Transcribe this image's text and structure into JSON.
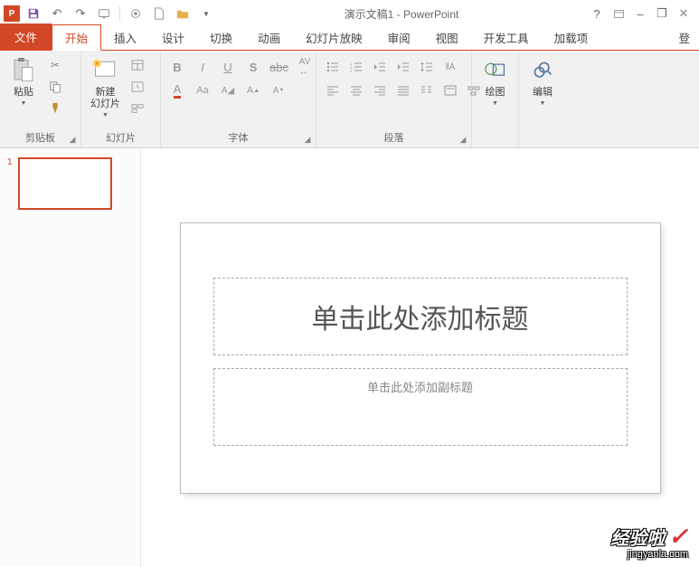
{
  "app": {
    "title": "演示文稿1 - PowerPoint"
  },
  "quick_access": {
    "save": "保存",
    "undo": "撤销",
    "redo": "重做",
    "start": "从头开始",
    "touch": "触摸/鼠标模式",
    "new": "新建",
    "open": "打开"
  },
  "window_buttons": {
    "help": "?",
    "ribbon_display": "▭",
    "minimize": "–",
    "restore": "❐",
    "close": "✕"
  },
  "tabs": {
    "file": "文件",
    "home": "开始",
    "insert": "插入",
    "design": "设计",
    "transitions": "切换",
    "animations": "动画",
    "slideshow": "幻灯片放映",
    "review": "审阅",
    "view": "视图",
    "developer": "开发工具",
    "addins": "加载项",
    "login": "登"
  },
  "ribbon": {
    "clipboard": {
      "label": "剪贴板",
      "paste": "粘贴",
      "cut": "剪切",
      "copy": "复制",
      "format_painter": "格式刷"
    },
    "slides": {
      "label": "幻灯片",
      "new_slide": "新建\n幻灯片"
    },
    "font": {
      "label": "字体"
    },
    "paragraph": {
      "label": "段落"
    },
    "drawing": {
      "label": "绘图"
    },
    "editing": {
      "label": "编辑"
    }
  },
  "slide": {
    "number": "1",
    "title_placeholder": "单击此处添加标题",
    "subtitle_placeholder": "单击此处添加副标题"
  },
  "watermark": {
    "main": "经验啦",
    "sub": "jingyanla.com"
  }
}
